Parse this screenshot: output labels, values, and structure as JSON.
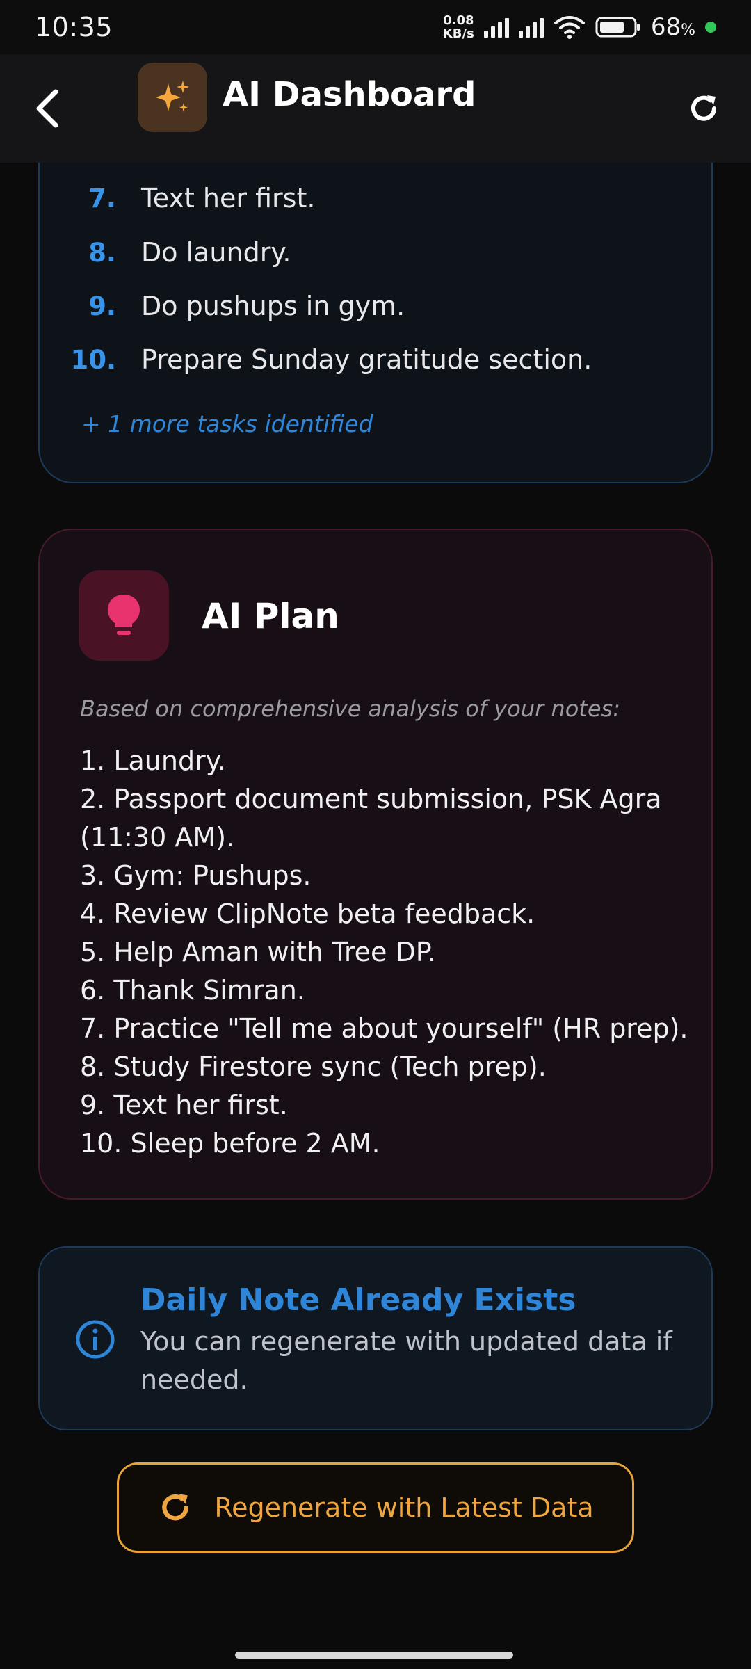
{
  "status_bar": {
    "time": "10:35",
    "net_speed_value": "0.08",
    "net_speed_unit": "KB/s",
    "battery_percent": "68",
    "battery_symbol": "%"
  },
  "app_bar": {
    "title": "AI Dashboard",
    "back_icon": "back-arrow-icon",
    "logo_icon": "sparkles-icon",
    "refresh_icon": "refresh-icon"
  },
  "tasks": {
    "items": [
      {
        "num": "7.",
        "text": "Text her first."
      },
      {
        "num": "8.",
        "text": "Do laundry."
      },
      {
        "num": "9.",
        "text": "Do pushups in gym."
      },
      {
        "num": "10.",
        "text": "Prepare Sunday gratitude section."
      }
    ],
    "more_label": "+ 1 more tasks identified"
  },
  "plan": {
    "title": "AI Plan",
    "icon": "lightbulb-icon",
    "intro": "Based on comprehensive analysis of your notes:",
    "lines": [
      "1. Laundry.",
      "2. Passport document submission, PSK Agra",
      "(11:30 AM).",
      "3. Gym: Pushups.",
      "4. Review ClipNote beta feedback.",
      "5. Help Aman with Tree DP.",
      "6. Thank Simran.",
      "7. Practice \"Tell me about yourself\" (HR prep).",
      "8. Study Firestore sync (Tech prep).",
      "9. Text her first.",
      "10. Sleep before 2 AM."
    ]
  },
  "info": {
    "title": "Daily Note Already Exists",
    "text": "You can regenerate with updated data if needed.",
    "icon": "info-icon"
  },
  "regenerate": {
    "label": "Regenerate with Latest Data",
    "icon": "refresh-icon"
  },
  "colors": {
    "accent_blue": "#3794ea",
    "accent_pink": "#e8336f",
    "accent_orange": "#f0a640",
    "background": "#0b0b0c"
  }
}
